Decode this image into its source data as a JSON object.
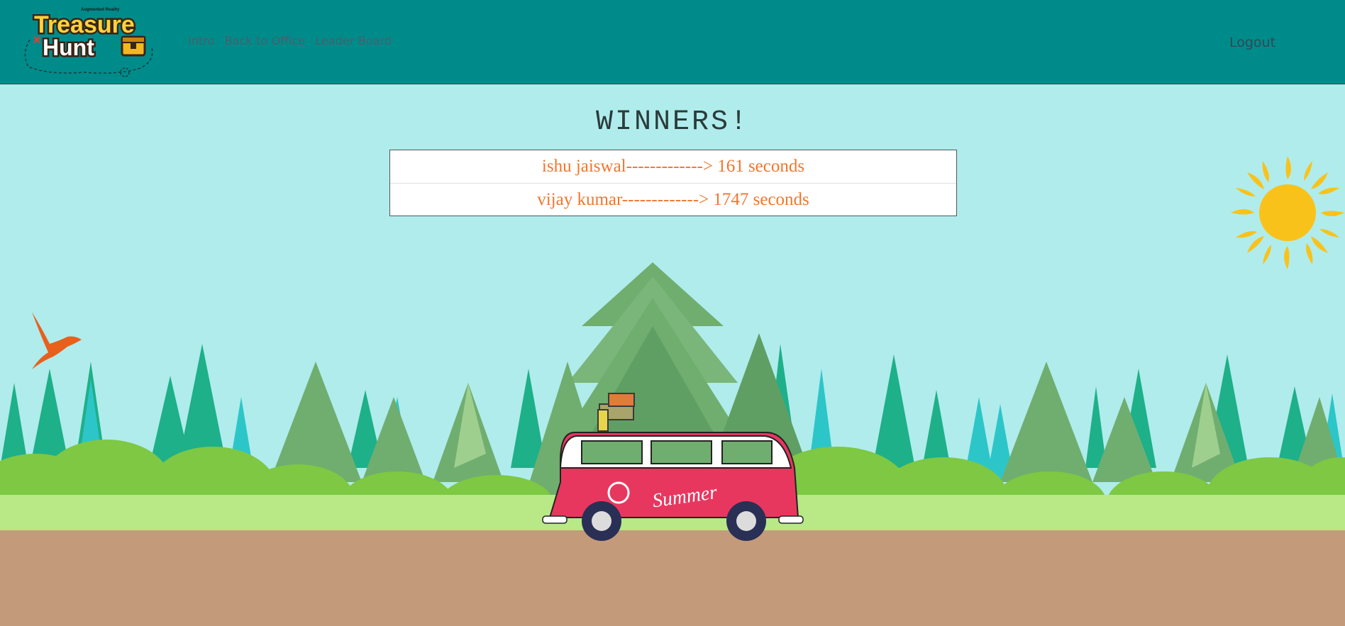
{
  "header": {
    "logo": {
      "top_text": "Augmented Reality",
      "line1": "Treasure",
      "line2": "Hunt"
    },
    "nav": [
      {
        "label": "Intro"
      },
      {
        "label": "Back to Office"
      },
      {
        "label": "Leader Board"
      }
    ],
    "logout_label": "Logout"
  },
  "main": {
    "title": "WINNERS!",
    "winners": [
      {
        "text": "ishu jaiswal-------------> 161 seconds"
      },
      {
        "text": "vijay kumar-------------> 1747 seconds"
      }
    ]
  },
  "scene": {
    "van_text": "Summer"
  },
  "colors": {
    "navbar": "#008b8b",
    "sky": "#b0ecec",
    "winner_text": "#f0762e",
    "ground": "#c49b7a",
    "grass": "#b8e986",
    "van": "#e8375f",
    "sun": "#f9c21a",
    "bird": "#e8601c"
  }
}
